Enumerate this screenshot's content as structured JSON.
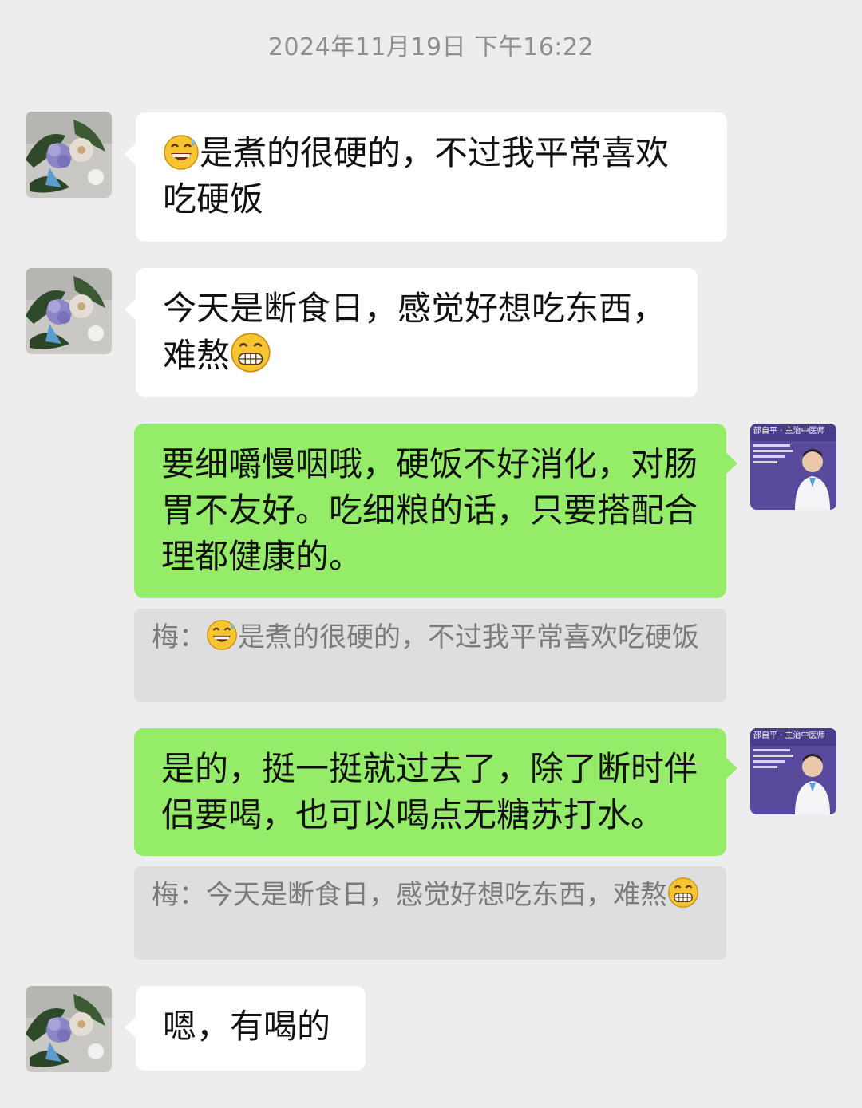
{
  "timestamp": "2024年11月19日 下午16:22",
  "messages": [
    {
      "text_after_emoji": "是煮的很硬的，不过我平常喜欢吃硬饭",
      "emoji": "grinning-sweat-emoji"
    },
    {
      "text_before_emoji": "今天是断食日，感觉好想吃东西，难熬",
      "emoji": "grimacing-emoji"
    },
    {
      "text": "要细嚼慢咽哦，硬饭不好消化，对肠胃不友好。吃细粮的话，只要搭配合理都健康的。"
    },
    {
      "quote_sender": "梅：",
      "quote_text": "是煮的很硬的，不过我平常喜欢吃硬饭",
      "emoji": "grinning-sweat-emoji"
    },
    {
      "text": "是的，挺一挺就过去了，除了断时伴侣要喝，也可以喝点无糖苏打水。"
    },
    {
      "quote_sender": "梅：",
      "quote_text": "今天是断食日，感觉好想吃东西，难熬",
      "emoji": "grimacing-emoji"
    },
    {
      "text": "嗯，有喝的"
    }
  ],
  "doctor_avatar": {
    "title": "邵自平 · 主治中医师"
  },
  "colors": {
    "background": "#ededed",
    "incoming_bubble": "#ffffff",
    "outgoing_bubble": "#95ec69",
    "quote_bg": "#dedede",
    "doctor_avatar_bg": "#5a4a9e"
  }
}
